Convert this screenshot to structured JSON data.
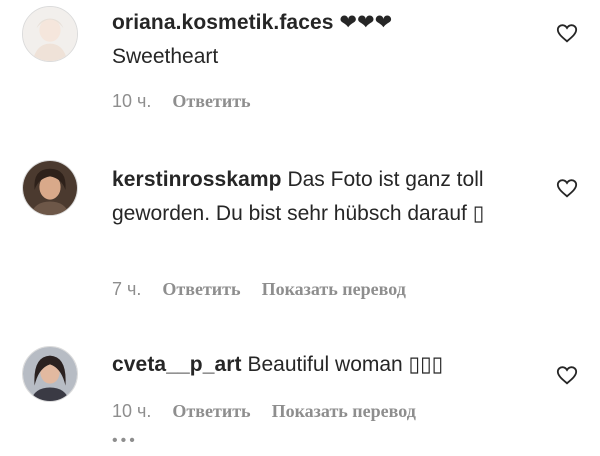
{
  "comments": [
    {
      "username": "oriana.kosmetik.faces",
      "text": "❤❤❤",
      "text2": "Sweetheart",
      "time": "10 ч.",
      "reply": "Ответить",
      "translate": ""
    },
    {
      "username": "kerstinrosskamp",
      "text": "Das Foto ist ganz toll geworden. Du bist sehr hübsch darauf ▯",
      "time": "7 ч.",
      "reply": "Ответить",
      "translate": "Показать перевод"
    },
    {
      "username": "cveta__p_art",
      "text": "Beautiful woman ▯▯▯",
      "time": "10 ч.",
      "reply": "Ответить",
      "translate": "Показать перевод"
    }
  ],
  "more": "•••",
  "icons": {
    "like": "heart-outline-icon"
  },
  "colors": {
    "text": "#262626",
    "meta": "#8e8e8e"
  }
}
